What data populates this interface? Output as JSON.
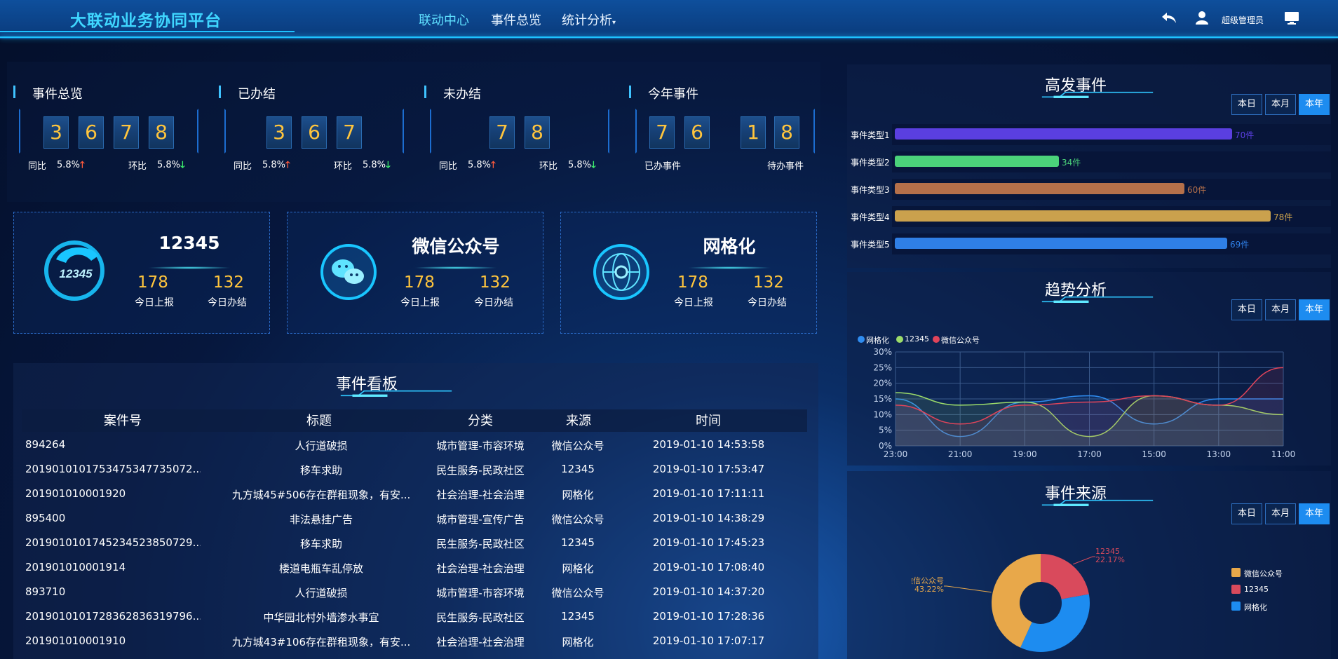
{
  "header": {
    "title": "大联动业务协同平台",
    "nav": [
      "联动中心",
      "事件总览",
      "统计分析"
    ],
    "user": "超级管理员"
  },
  "stats": [
    {
      "title": "事件总览",
      "digits": [
        "3",
        "6",
        "7",
        "8"
      ],
      "yoy_label": "同比",
      "yoy": "5.8%",
      "mom_label": "环比",
      "mom": "5.8%"
    },
    {
      "title": "已办结",
      "digits": [
        "3",
        "6",
        "7"
      ],
      "yoy_label": "同比",
      "yoy": "5.8%",
      "mom_label": "环比",
      "mom": "5.8%"
    },
    {
      "title": "未办结",
      "digits": [
        "7",
        "8"
      ],
      "yoy_label": "同比",
      "yoy": "5.8%",
      "mom_label": "环比",
      "mom": "5.8%"
    },
    {
      "title": "今年事件",
      "done_digits": [
        "7",
        "6"
      ],
      "pending_digits": [
        "1",
        "8"
      ],
      "done_label": "已办事件",
      "pending_label": "待办事件"
    }
  ],
  "cards": [
    {
      "name": "12345",
      "icon": "phone-12345-icon",
      "report": "178",
      "report_label": "今日上报",
      "done": "132",
      "done_label": "今日办结"
    },
    {
      "name": "微信公众号",
      "icon": "wechat-icon",
      "report": "178",
      "report_label": "今日上报",
      "done": "132",
      "done_label": "今日办结"
    },
    {
      "name": "网格化",
      "icon": "grid-globe-icon",
      "report": "178",
      "report_label": "今日上报",
      "done": "132",
      "done_label": "今日办结"
    }
  ],
  "board": {
    "title": "事件看板",
    "columns": [
      "案件号",
      "标题",
      "分类",
      "来源",
      "时间"
    ],
    "rows": [
      [
        "894264",
        "人行道破损",
        "城市管理-市容环境",
        "微信公众号",
        "2019-01-10 14:53:58"
      ],
      [
        "20190101017534753477350​72...",
        "移车求助",
        "民生服务-民政社区",
        "12345",
        "2019-01-10 17:53:47"
      ],
      [
        "201901010001920",
        "九方城45#506存在群租现象，有安...",
        "社会治理-社会治理",
        "网格化",
        "2019-01-10 17:11:11"
      ],
      [
        "895400",
        "非法悬挂广告",
        "城市管理-宣传广告",
        "微信公众号",
        "2019-01-10 14:38:29"
      ],
      [
        "20190101017452345238507​29...",
        "移车求助",
        "民生服务-民政社区",
        "12345",
        "2019-01-10 17:45:23"
      ],
      [
        "201901010001914",
        "楼道电瓶车乱停放",
        "社会治理-社会治理",
        "网格化",
        "2019-01-10 17:08:40"
      ],
      [
        "893710",
        "人行道破损",
        "城市管理-市容环境",
        "微信公众号",
        "2019-01-10 14:37:20"
      ],
      [
        "20190101017283628363197​96...",
        "中华园北村外墙渗水事宜",
        "民生服务-民政社区",
        "12345",
        "2019-01-10 17:28:36"
      ],
      [
        "201901010001910",
        "九方城43#106存在群租现象，有安...",
        "社会治理-社会治理",
        "网格化",
        "2019-01-10 17:07:17"
      ]
    ]
  },
  "period_buttons": [
    "本日",
    "本月",
    "本年"
  ],
  "high_events": {
    "title": "高发事件",
    "items": [
      {
        "label": "事件类型1",
        "value": 70,
        "text": "70件",
        "color": "#5a3fe0"
      },
      {
        "label": "事件类型2",
        "value": 34,
        "text": "34件",
        "color": "#4bd27a"
      },
      {
        "label": "事件类型3",
        "value": 60,
        "text": "60件",
        "color": "#b5704a"
      },
      {
        "label": "事件类型4",
        "value": 78,
        "text": "78件",
        "color": "#caa14d"
      },
      {
        "label": "事件类型5",
        "value": 69,
        "text": "69件",
        "color": "#2f7fe6"
      }
    ]
  },
  "trend": {
    "title": "趋势分析",
    "chart_data": {
      "type": "line",
      "x": [
        "23:00",
        "21:00",
        "19:00",
        "17:00",
        "15:00",
        "13:00",
        "11:00"
      ],
      "ylim": [
        0,
        30
      ],
      "yticks": [
        "30%",
        "25%",
        "20%",
        "15%",
        "10%",
        "5%",
        "0%"
      ],
      "series": [
        {
          "name": "网格化",
          "color": "#2f8cf0",
          "values": [
            15,
            3,
            14,
            16,
            7,
            15,
            15
          ]
        },
        {
          "name": "12345",
          "color": "#9cdc6a",
          "values": [
            17,
            13,
            14,
            3,
            16,
            13,
            10
          ]
        },
        {
          "name": "微信公众号",
          "color": "#e0445a",
          "values": [
            13,
            7,
            13,
            14,
            16,
            13,
            25
          ]
        }
      ]
    }
  },
  "source": {
    "title": "事件来源",
    "chart_data": {
      "type": "pie",
      "slices": [
        {
          "name": "微信公众号",
          "value": 43.22,
          "label": "43.22%",
          "color": "#e8a84a"
        },
        {
          "name": "12345",
          "value": 22.17,
          "label": "22.17%",
          "color": "#d94a5c"
        },
        {
          "name": "网格化",
          "value": 34.61,
          "color": "#1d8cf0"
        }
      ]
    }
  }
}
